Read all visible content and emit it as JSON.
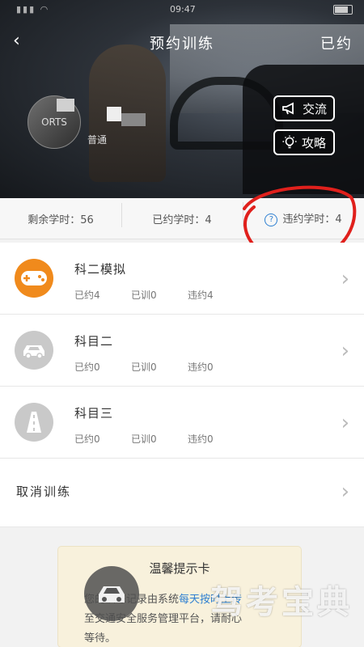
{
  "status_bar": {
    "time": "09:47"
  },
  "nav": {
    "back_label": "‹",
    "title": "预约训练",
    "right_label": "已约"
  },
  "profile": {
    "avatar_text": "ORTS",
    "username": "普通"
  },
  "hero_buttons": {
    "chat_label": "交流",
    "guide_label": "攻略"
  },
  "stats": {
    "remaining_label": "剩余学时：56",
    "booked_label": "已约学时：4",
    "violation_label": "违约学时：4"
  },
  "rows": [
    {
      "name": "科二模拟",
      "booked": "已约4",
      "trained": "已训0",
      "violated": "违约4",
      "icon": "gamepad-icon",
      "active": true
    },
    {
      "name": "科目二",
      "booked": "已约0",
      "trained": "已训0",
      "violated": "违约0",
      "icon": "car-icon",
      "active": false
    },
    {
      "name": "科目三",
      "booked": "已约0",
      "trained": "已训0",
      "violated": "违约0",
      "icon": "road-icon",
      "active": false
    }
  ],
  "cancel": {
    "label": "取消训练"
  },
  "tip_card": {
    "title": "温馨提示卡",
    "line1_a": "您的训练记录由系统",
    "line1_b": "每天按时上传",
    "line2": "至交通安全服务管理平台，请耐心",
    "line3": "等待。"
  },
  "watermark": "驾考宝典",
  "colors": {
    "accent": "#f08a1c",
    "link": "#2d7fd1",
    "annotation": "#e0201c"
  }
}
